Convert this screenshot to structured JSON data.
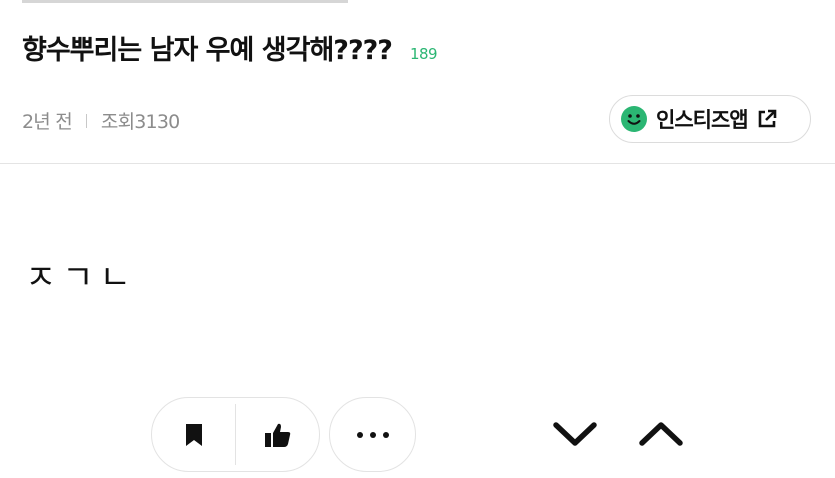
{
  "post": {
    "title": "향수뿌리는 남자 우예 생각해????",
    "comment_count": "189",
    "time_ago": "2년 전",
    "views": "조회3130",
    "body": "ㅈㄱㄴ"
  },
  "app_button": {
    "label": "인스티즈앱",
    "icon": "smile-icon",
    "accent": "#2bb673"
  },
  "actions": {
    "bookmark_icon": "bookmark-icon",
    "like_icon": "thumbs-up-icon",
    "more_icon": "more-icon",
    "down_icon": "chevron-down-icon",
    "up_icon": "chevron-up-icon"
  },
  "colors": {
    "accent": "#2bb673",
    "meta": "#8c8c8c",
    "text": "#111111"
  }
}
